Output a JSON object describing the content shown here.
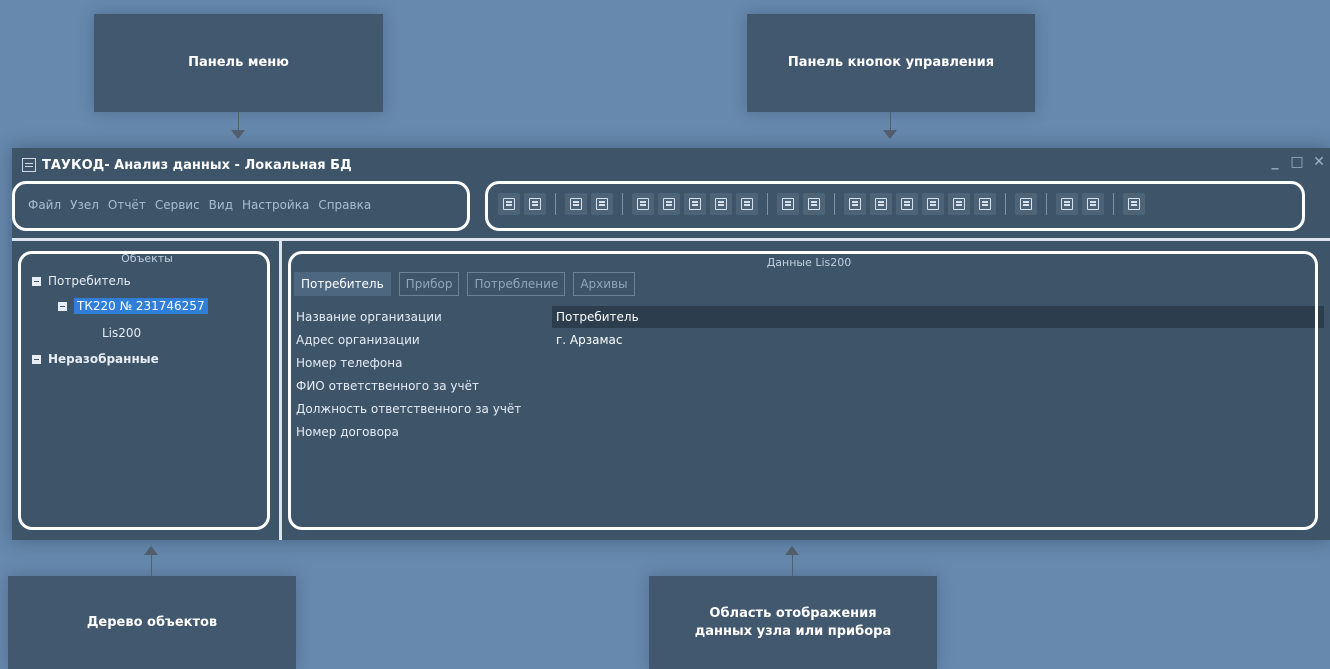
{
  "callouts": {
    "menu_panel": "Панель меню",
    "control_buttons_panel": "Панель кнопок управления",
    "object_tree": "Дерево объектов",
    "data_area_line1": "Область отображения",
    "data_area_line2": "данных узла или прибора"
  },
  "window": {
    "title": "ТАУКОД- Анализ данных - Локальная БД",
    "controls": {
      "minimize": "_",
      "maximize": "□",
      "close": "✕"
    }
  },
  "menu": {
    "items": [
      "Файл",
      "Узел",
      "Отчёт",
      "Сервис",
      "Вид",
      "Настройка",
      "Справка"
    ]
  },
  "toolbar": {
    "groups": [
      [
        "list-add-icon",
        "list-filter-icon"
      ],
      [
        "copy-icon",
        "list-icon"
      ],
      [
        "tree-query-icon",
        "add-node-icon",
        "tree-branch-icon",
        "device-icon",
        "document-icon"
      ],
      [
        "chart-icon",
        "report-icon"
      ],
      [
        "monitor-icon",
        "calculator-icon",
        "hand-cursor-icon",
        "export-icon",
        "table-icon",
        "import-icon"
      ],
      [
        "settings-gear-icon"
      ],
      [
        "database-table-icon",
        "database-icon"
      ],
      [
        "stack-icon"
      ]
    ]
  },
  "tree": {
    "header": "Объекты",
    "consumer": "Потребитель",
    "device": "ТК220 № 231746257",
    "child": "Lis200",
    "unsorted": "Неразобранные"
  },
  "content": {
    "header": "Данные Lis200",
    "tabs": [
      "Потребитель",
      "Прибор",
      "Потребление",
      "Архивы"
    ],
    "active_tab": "Потребитель",
    "fields": [
      {
        "label": "Название организации",
        "value": "Потребитель"
      },
      {
        "label": "Адрес организации",
        "value": "г. Арзамас"
      },
      {
        "label": "Номер телефона",
        "value": ""
      },
      {
        "label": "ФИО ответственного за учёт",
        "value": ""
      },
      {
        "label": "Должность ответственного за учёт",
        "value": ""
      },
      {
        "label": "Номер договора",
        "value": ""
      }
    ]
  }
}
